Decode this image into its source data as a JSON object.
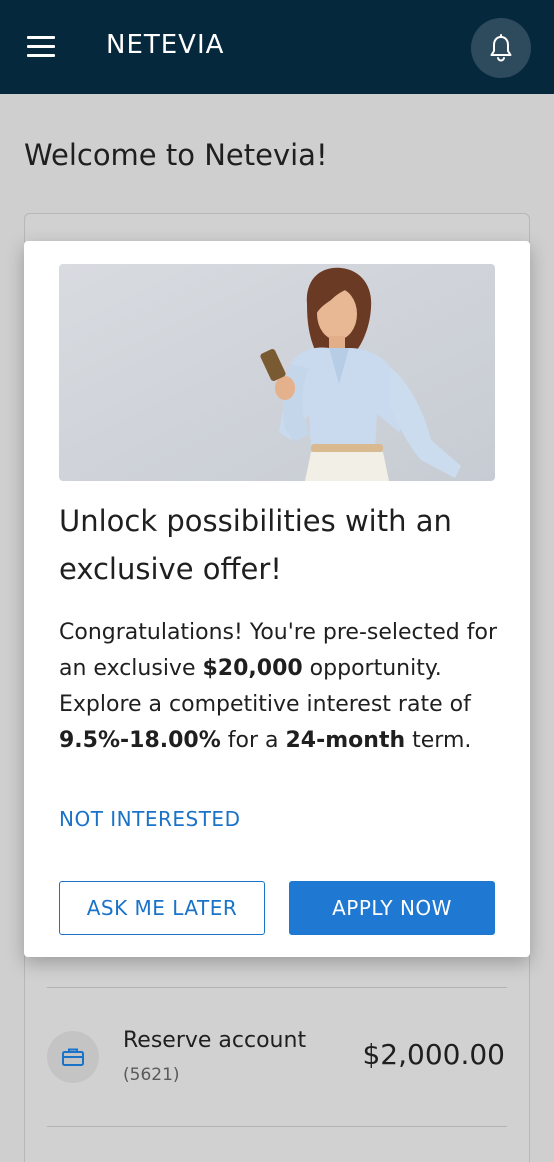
{
  "header": {
    "logo": "NETEVIA"
  },
  "page": {
    "welcome": "Welcome to Netevia!"
  },
  "account": {
    "name": "Reserve account",
    "number": "(5621)",
    "balance": "$2,000.00"
  },
  "modal": {
    "title": "Unlock possibilities with an exclusive offer!",
    "body": {
      "t1": "Congratulations! You're pre-selected for an exclusive ",
      "amount": "$20,000",
      "t2": " opportunity. Explore a competitive interest rate of ",
      "rate": "9.5%-18.00%",
      "t3": " for a ",
      "term": "24-month",
      "t4": " term."
    },
    "not_interested": "NOT INTERESTED",
    "ask_later": "ASK ME LATER",
    "apply_now": "APPLY NOW"
  },
  "colors": {
    "header_bg": "#06283d",
    "accent": "#1f78d1",
    "link": "#1a73c9"
  },
  "icons": {
    "menu": "hamburger-menu-icon",
    "notifications": "bell-icon",
    "account": "briefcase-icon"
  }
}
